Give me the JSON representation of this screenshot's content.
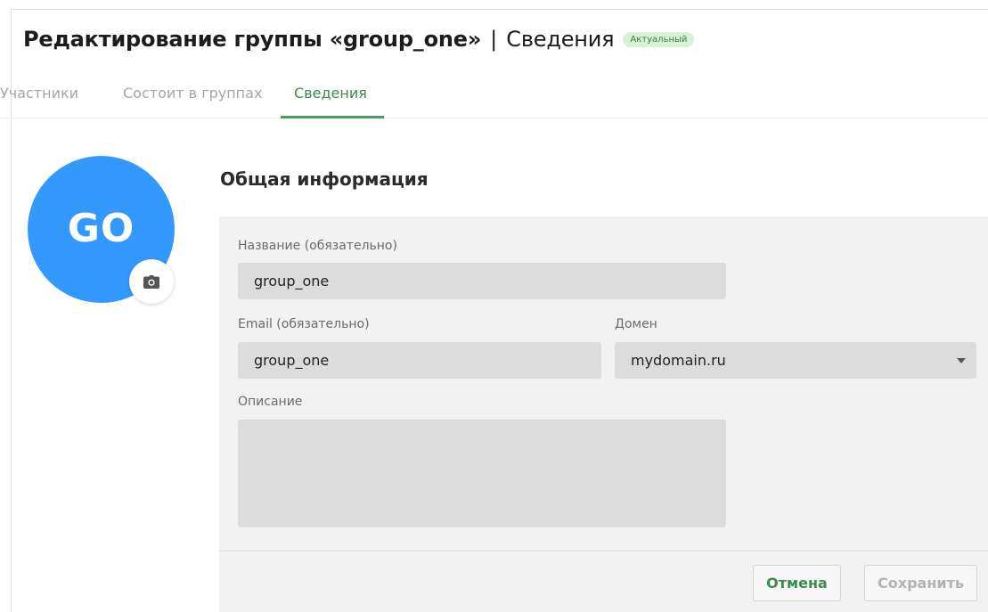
{
  "header": {
    "title": "Редактирование группы «group_one»",
    "separator": "|",
    "section": "Сведения",
    "status_badge": "Актуальный"
  },
  "tabs": [
    {
      "label": "Участники",
      "active": false
    },
    {
      "label": "Состоит в группах",
      "active": false
    },
    {
      "label": "Сведения",
      "active": true
    }
  ],
  "avatar": {
    "initials": "GO",
    "color": "#3399ff",
    "icon": "camera-icon"
  },
  "form": {
    "section_title": "Общая информация",
    "name": {
      "label": "Название (обязательно)",
      "value": "group_one"
    },
    "email": {
      "label": "Email (обязательно)",
      "value": "group_one"
    },
    "domain": {
      "label": "Домен",
      "value": "mydomain.ru",
      "icon": "chevron-down-icon"
    },
    "description": {
      "label": "Описание",
      "value": ""
    }
  },
  "actions": {
    "cancel_label": "Отмена",
    "save_label": "Сохранить"
  },
  "colors": {
    "accent": "#3d8b4e",
    "badge_bg": "#d8f2d8",
    "panel_bg": "#f2f2f2",
    "field_bg": "#dcdcdd"
  }
}
